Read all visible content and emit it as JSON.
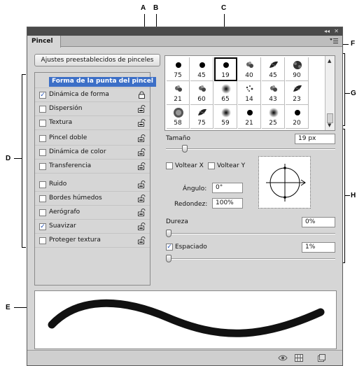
{
  "callouts": {
    "a": "A",
    "b": "B",
    "c": "C",
    "d": "D",
    "e": "E",
    "f": "F",
    "g": "G",
    "h": "H"
  },
  "window": {
    "collapse_glyph": "◂◂",
    "close_glyph": "✕"
  },
  "panel": {
    "tab_label": "Pincel",
    "menu_icon": "panel-menu-icon"
  },
  "presets_button": "Ajustes preestablecidos de pinceles",
  "options": [
    {
      "label": "Forma de la punta del pincel",
      "checkbox": false,
      "selected": true
    },
    {
      "label": "Dinámica de forma",
      "checked": true,
      "lock": "lock-closed-icon"
    },
    {
      "label": "Dispersión",
      "checked": false,
      "lock": "lock-open-icon"
    },
    {
      "label": "Textura",
      "checked": false,
      "lock": "lock-open-icon"
    },
    {
      "label": "Pincel doble",
      "checked": false,
      "lock": "lock-open-icon"
    },
    {
      "label": "Dinámica de color",
      "checked": false,
      "lock": "lock-open-icon"
    },
    {
      "label": "Transferencia",
      "checked": false,
      "lock": "lock-open-icon"
    },
    {
      "label": "Ruido",
      "checked": false,
      "lock": "lock-open-icon"
    },
    {
      "label": "Bordes húmedos",
      "checked": false,
      "lock": "lock-open-icon"
    },
    {
      "label": "Aerógrafo",
      "checked": false,
      "lock": "lock-open-icon"
    },
    {
      "label": "Suavizar",
      "checked": true,
      "lock": "lock-open-icon"
    },
    {
      "label": "Proteger textura",
      "checked": false,
      "lock": "lock-open-icon"
    }
  ],
  "check_glyph": "✓",
  "brushes": [
    [
      "75",
      "45",
      "19",
      "40",
      "45",
      "90"
    ],
    [
      "21",
      "60",
      "65",
      "14",
      "43",
      "23"
    ],
    [
      "58",
      "75",
      "59",
      "21",
      "25",
      "20"
    ]
  ],
  "selected_brush": {
    "row": 0,
    "col": 2
  },
  "tip": {
    "size_label": "Tamaño",
    "size_value": "19 px",
    "size_fraction": 0.1,
    "flip_x_label": "Voltear X",
    "flip_y_label": "Voltear Y",
    "angle_label": "Ángulo:",
    "angle_value": "0°",
    "roundness_label": "Redondez:",
    "roundness_value": "100%",
    "hardness_label": "Dureza",
    "hardness_value": "0%",
    "hardness_fraction": 0.0,
    "spacing_label": "Espaciado",
    "spacing_checked": true,
    "spacing_value": "1%",
    "spacing_fraction": 0.0
  },
  "bottom_icons": [
    "visibility-eye-icon",
    "grid-icon",
    "new-page-icon"
  ],
  "colors": {
    "selection": "#3c6fc7",
    "stroke": "#111111"
  }
}
